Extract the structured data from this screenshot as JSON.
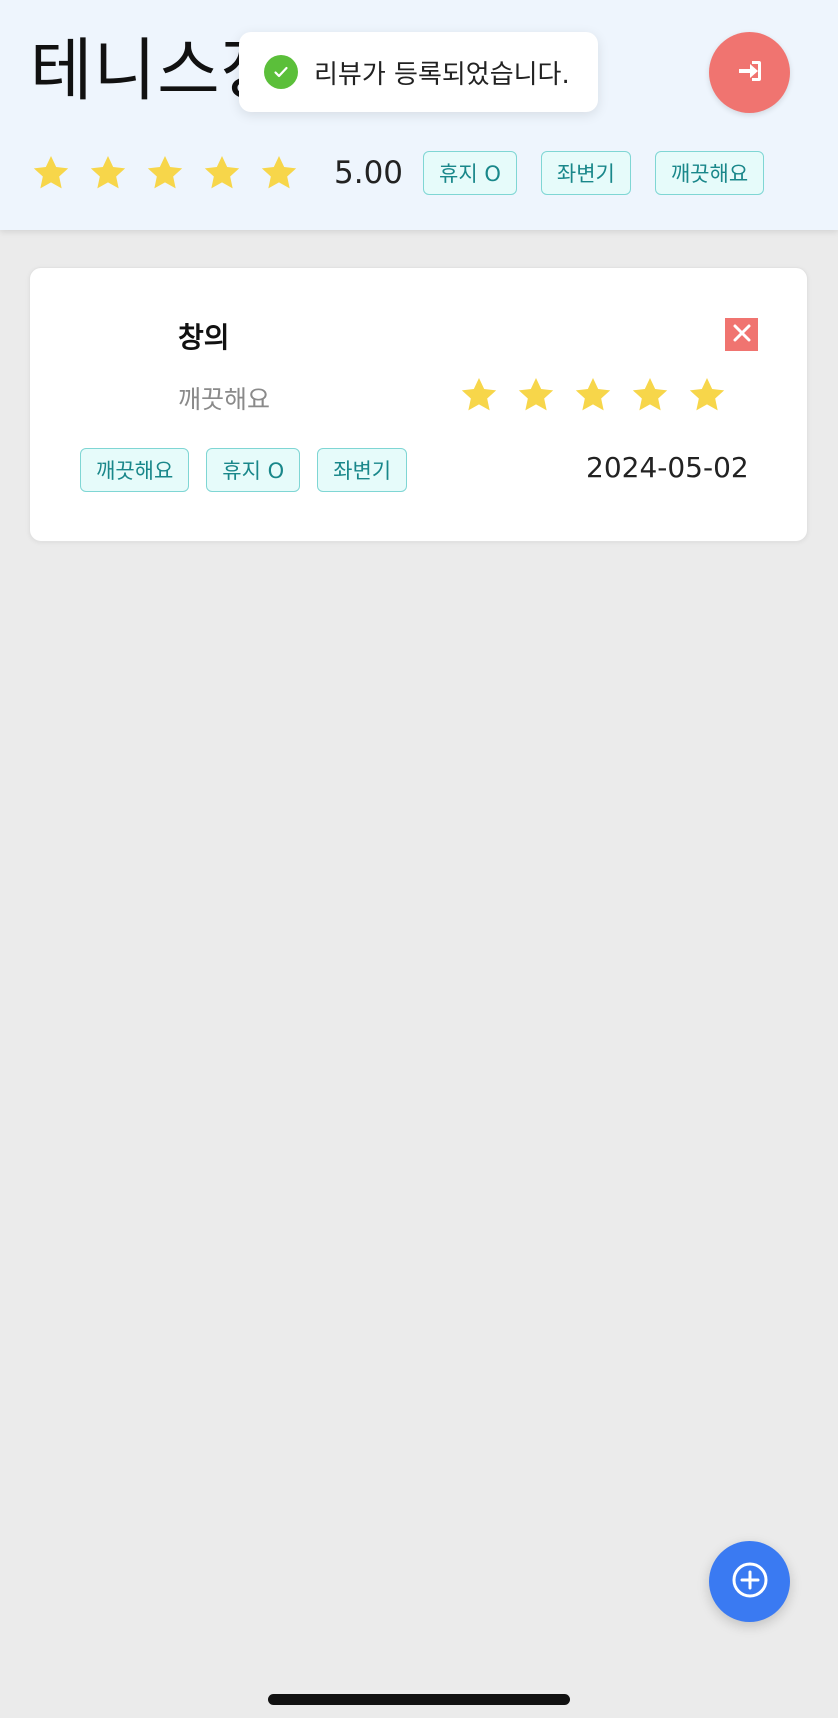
{
  "header": {
    "title": "테니스장",
    "rating": {
      "stars": 5,
      "average": "5.00"
    },
    "tags": [
      "휴지 O",
      "좌변기",
      "깨끗해요"
    ]
  },
  "toast": {
    "message": "리뷰가 등록되었습니다.",
    "icon": "check-circle-icon"
  },
  "reviews": [
    {
      "author": "창의",
      "comment": "깨끗해요",
      "stars": 5,
      "tags": [
        "깨끗해요",
        "휴지 O",
        "좌변기"
      ],
      "date": "2024-05-02"
    }
  ],
  "colors": {
    "header_bg": "#eef5fd",
    "login_button": "#f07470",
    "fab": "#3a7af2",
    "star": "#f7d64a",
    "tag_border": "#7fd6d4",
    "tag_text": "#19878a",
    "toast_check": "#5bbf3a"
  },
  "icons": {
    "login": "sign-in-icon",
    "delete": "close-icon",
    "add": "plus-circle-icon",
    "star": "star-icon"
  }
}
